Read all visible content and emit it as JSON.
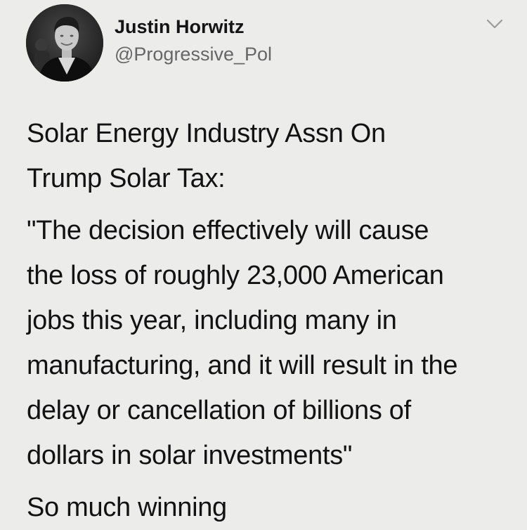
{
  "author": {
    "display_name": "Justin Horwitz",
    "handle": "@Progressive_Pol"
  },
  "menu": {
    "icon": "chevron-down-icon"
  },
  "avatar": {
    "icon": "profile-photo"
  },
  "tweet": {
    "paragraphs": [
      "Solar Energy Industry Assn On\nTrump Solar Tax:",
      "\"The decision effectively will cause\nthe loss of roughly 23,000 American\njobs this year, including many in\nmanufacturing, and it will result in the\ndelay or cancellation of billions of\ndollars in solar investments\"",
      "So much winning"
    ]
  },
  "colors": {
    "background": "#ececea",
    "text": "#121212",
    "handle": "#666666",
    "chevron": "#9a9a9a"
  }
}
